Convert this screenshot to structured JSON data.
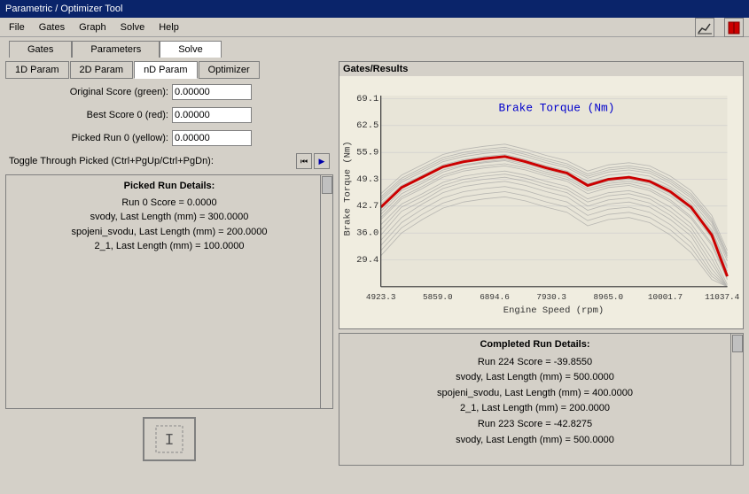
{
  "title": "Parametric / Optimizer Tool",
  "menu": {
    "items": [
      "File",
      "Gates",
      "Graph",
      "Solve",
      "Help"
    ]
  },
  "tabs_top": {
    "items": [
      "Gates",
      "Parameters",
      "Solve"
    ],
    "active": 2
  },
  "sub_tabs": {
    "items": [
      "1D Param",
      "2D Param",
      "nD Param",
      "Optimizer"
    ],
    "active": 2
  },
  "fields": {
    "original_score_label": "Original Score (green):",
    "original_score_value": "0.00000",
    "best_score_label": "Best Score 0 (red):",
    "best_score_value": "0.00000",
    "picked_run_label": "Picked Run 0 (yellow):",
    "picked_run_value": "0.00000"
  },
  "toggle": {
    "label": "Toggle Through Picked (Ctrl+PgUp/Ctrl+PgDn):"
  },
  "picked_run": {
    "title": "Picked Run Details:",
    "lines": [
      "Run 0  Score = 0.0000",
      "svody, Last Length (mm) = 300.0000",
      "spojeni_svodu, Last Length (mm) = 200.0000",
      "2_1, Last Length (mm) = 100.0000"
    ]
  },
  "completed_run": {
    "title": "Completed Run Details:",
    "lines": [
      "Run 224  Score = -39.8550",
      "svody, Last Length (mm) = 500.0000",
      "spojeni_svodu, Last Length (mm) = 400.0000",
      "2_1, Last Length (mm) = 200.0000",
      "Run 223  Score = -42.8275",
      "svody, Last Length (mm) = 500.0000"
    ]
  },
  "graph": {
    "section_title": "Gates/Results",
    "chart_title": "Brake Torque (Nm)",
    "y_axis_label": "Brake Torque (Nm)",
    "x_axis_label": "Engine Speed (rpm)",
    "x_min": "4923.3",
    "x_max": "11037.4",
    "y_ticks": [
      "69.1",
      "62.5",
      "55.9",
      "49.3",
      "42.7",
      "36.0",
      "29.4"
    ],
    "x_ticks": [
      "4923.3",
      "5859.0",
      "6894.6",
      "7930.3",
      "8965.0",
      "10001.7",
      "11037.4"
    ]
  },
  "toolbar": {
    "graph_icon": "📈",
    "book_icon": "📕"
  }
}
